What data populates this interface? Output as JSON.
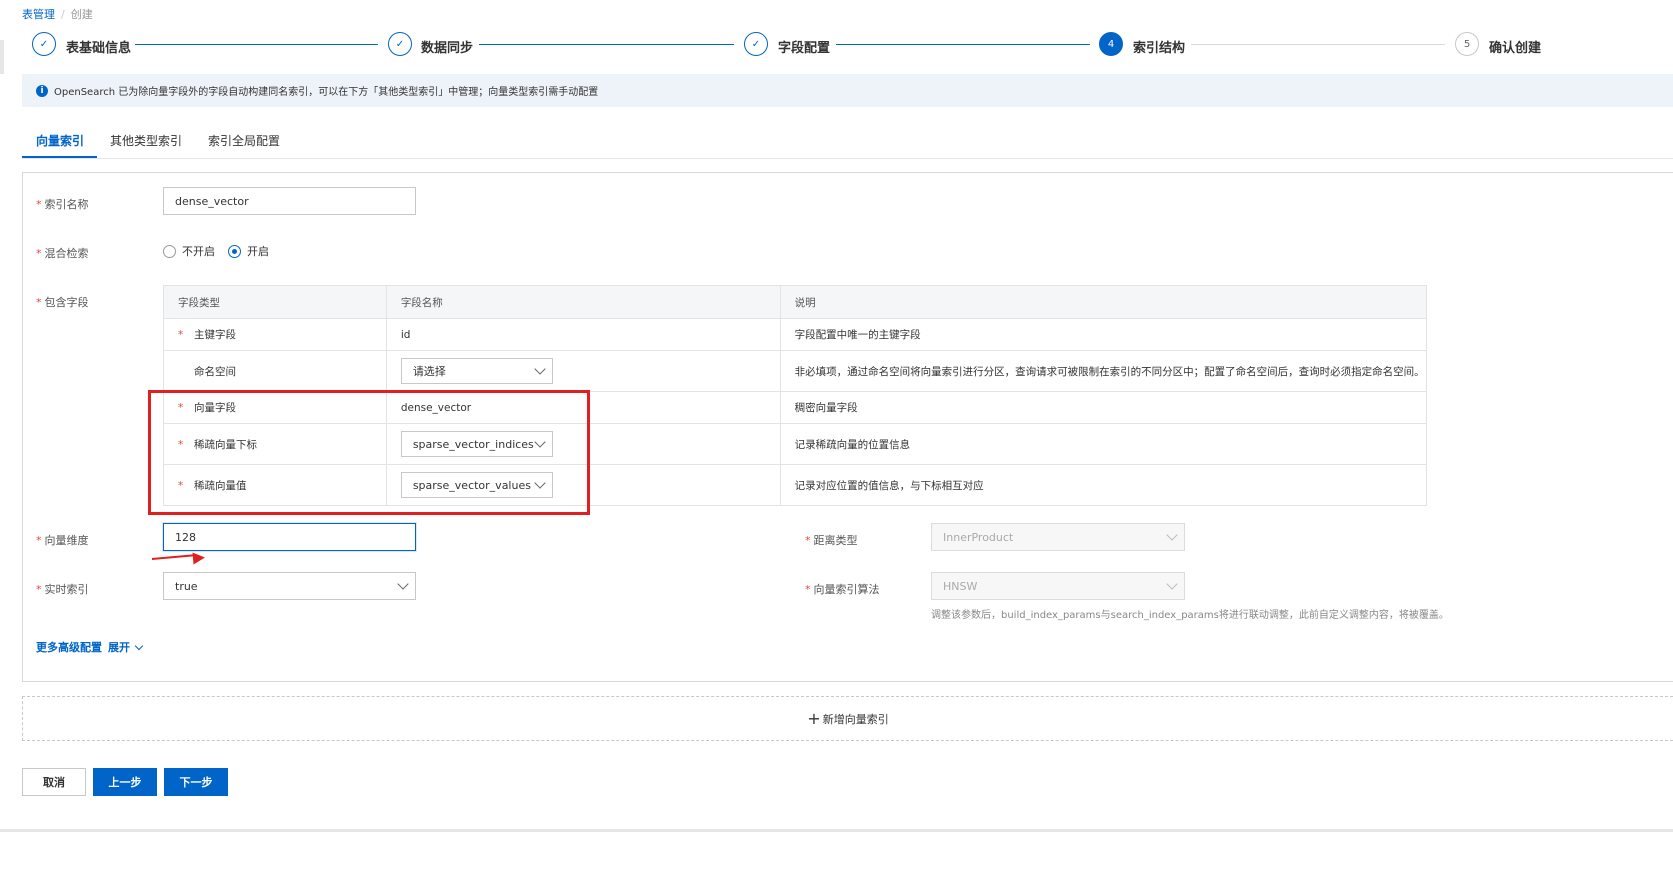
{
  "breadcrumb": {
    "parent": "表管理",
    "current": "创建"
  },
  "steps": [
    {
      "label": "表基础信息",
      "status": "done"
    },
    {
      "label": "数据同步",
      "status": "done"
    },
    {
      "label": "字段配置",
      "status": "done"
    },
    {
      "label": "索引结构",
      "number": "4",
      "status": "active"
    },
    {
      "label": "确认创建",
      "number": "5",
      "status": "todo"
    }
  ],
  "info_banner": "OpenSearch 已为除向量字段外的字段自动构建同名索引，可以在下方「其他类型索引」中管理；向量类型索引需手动配置",
  "tabs": [
    "向量索引",
    "其他类型索引",
    "索引全局配置"
  ],
  "form": {
    "index_name": {
      "label": "索引名称",
      "value": "dense_vector"
    },
    "hybrid_search": {
      "label": "混合检索",
      "options": [
        "不开启",
        "开启"
      ],
      "selected": "开启"
    },
    "fields_label": "包含字段",
    "vector_dimension": {
      "label": "向量维度",
      "value": "128"
    },
    "realtime_index": {
      "label": "实时索引",
      "value": "true"
    },
    "distance_type": {
      "label": "距离类型",
      "value": "InnerProduct"
    },
    "vector_algorithm": {
      "label": "向量索引算法",
      "value": "HNSW"
    },
    "algorithm_hint": "调整该参数后，build_index_params与search_index_params将进行联动调整，此前自定义调整内容，将被覆盖。",
    "advanced": {
      "label": "更多高级配置",
      "toggle": "展开"
    }
  },
  "fields_table": {
    "headers": [
      "字段类型",
      "字段名称",
      "说明"
    ],
    "rows": [
      {
        "type": "主键字段",
        "required": true,
        "name": "id",
        "is_select": false,
        "desc": "字段配置中唯一的主键字段"
      },
      {
        "type": "命名空间",
        "required": false,
        "name": "请选择",
        "is_select": true,
        "desc": "非必填项，通过命名空间将向量索引进行分区，查询请求可被限制在索引的不同分区中；配置了命名空间后，查询时必须指定命名空间。"
      },
      {
        "type": "向量字段",
        "required": true,
        "name": "dense_vector",
        "is_select": false,
        "desc": "稠密向量字段"
      },
      {
        "type": "稀疏向量下标",
        "required": true,
        "name": "sparse_vector_indices",
        "is_select": true,
        "desc": "记录稀疏向量的位置信息"
      },
      {
        "type": "稀疏向量值",
        "required": true,
        "name": "sparse_vector_values",
        "is_select": true,
        "desc": "记录对应位置的值信息，与下标相互对应"
      }
    ]
  },
  "add_vector_index": "新增向量索引",
  "buttons": {
    "cancel": "取消",
    "prev": "上一步",
    "next": "下一步"
  },
  "colors": {
    "primary": "#0064c8",
    "required": "#e84738",
    "annotation": "#e02020"
  }
}
